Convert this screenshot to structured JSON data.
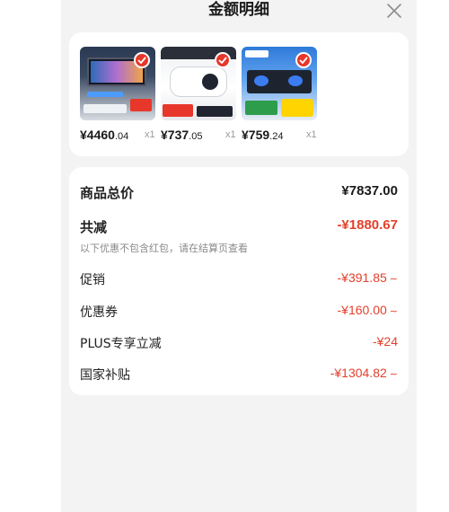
{
  "header": {
    "title": "金额明细"
  },
  "products": [
    {
      "price_int": "¥4460",
      "price_dec": ".04",
      "qty": "x1"
    },
    {
      "price_int": "¥737",
      "price_dec": ".05",
      "qty": "x1"
    },
    {
      "price_int": "¥759",
      "price_dec": ".24",
      "qty": "x1"
    }
  ],
  "summary": {
    "total_label": "商品总价",
    "total_value": "¥7837.00",
    "discount_label": "共减",
    "discount_value": "-¥1880.67",
    "discount_note": "以下优惠不包含红包，请在结算页查看",
    "items": [
      {
        "label": "促销",
        "value": "-¥391.85"
      },
      {
        "label": "优惠券",
        "value": "-¥160.00"
      },
      {
        "label": "PLUS专享立减",
        "value": "-¥24"
      },
      {
        "label": "国家补贴",
        "value": "-¥1304.82"
      }
    ]
  },
  "colors": {
    "accent_red": "#e2412c",
    "card_bg": "#ffffff",
    "sheet_bg": "#f3f3f4"
  },
  "icons": {
    "close": "close-icon",
    "check": "check-icon",
    "chevron": "chevron-down-icon"
  }
}
